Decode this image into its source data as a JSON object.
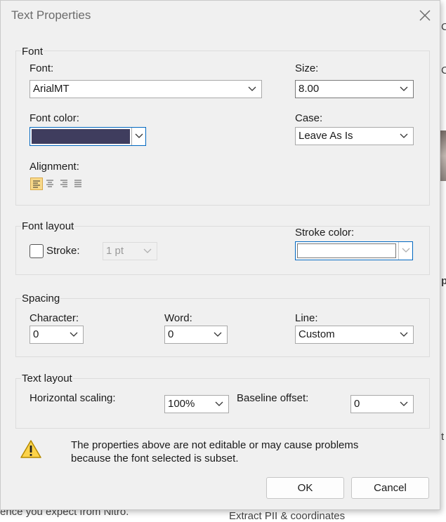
{
  "background": {
    "bottom_left_text": "ence you expect from Nitro.",
    "bottom_right_text": "Extract PII & coordinates",
    "edge_glyphs": [
      "C",
      "C",
      "s",
      "p",
      "t",
      "s"
    ]
  },
  "dialog": {
    "title": "Text Properties",
    "close_icon": "close-icon"
  },
  "font_group": {
    "label": "Font",
    "font_label": "Font:",
    "font_value": "ArialMT",
    "size_label": "Size:",
    "size_value": "8.00",
    "color_label": "Font color:",
    "color_value": "#3f3d5e",
    "case_label": "Case:",
    "case_value": "Leave As Is",
    "alignment_label": "Alignment:",
    "alignment_options": [
      "align-left",
      "align-center",
      "align-right",
      "align-justify"
    ],
    "alignment_selected": "align-left"
  },
  "font_layout_group": {
    "label": "Font layout",
    "stroke_label": "Stroke:",
    "stroke_checked": false,
    "stroke_width_value": "1 pt",
    "stroke_color_label": "Stroke color:",
    "stroke_color_value": "#ffffff"
  },
  "spacing_group": {
    "label": "Spacing",
    "character_label": "Character:",
    "character_value": "0",
    "word_label": "Word:",
    "word_value": "0",
    "line_label": "Line:",
    "line_value": "Custom"
  },
  "text_layout_group": {
    "label": "Text layout",
    "hscale_label": "Horizontal scaling:",
    "hscale_value": "100%",
    "baseline_label": "Baseline offset:",
    "baseline_value": "0"
  },
  "warning": {
    "icon": "warning-icon",
    "line1": "The properties above are not editable or may cause problems",
    "line2": "because the font selected is subset."
  },
  "buttons": {
    "ok": "OK",
    "cancel": "Cancel"
  },
  "colors": {
    "accent": "#0067c0",
    "selected_align_bg": "#f8d98a"
  }
}
